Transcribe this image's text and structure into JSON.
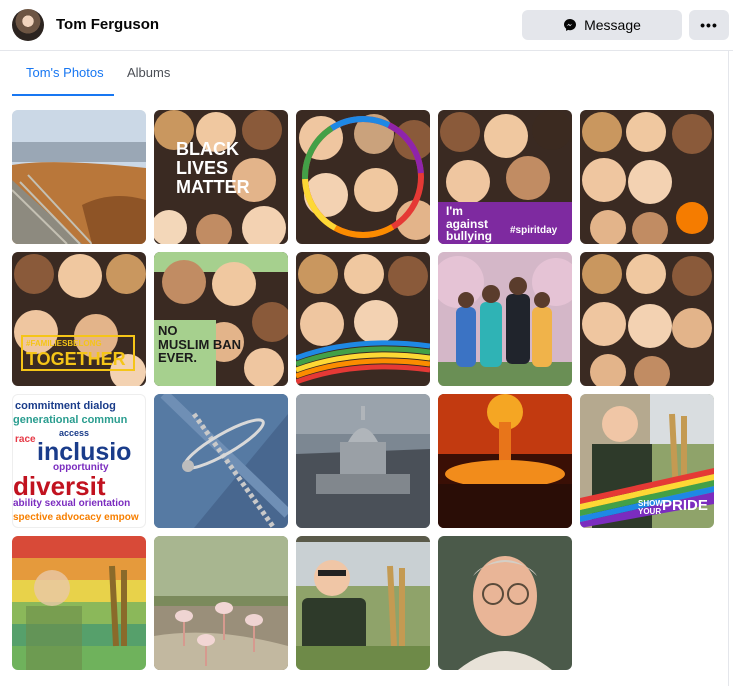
{
  "header": {
    "name": "Tom Ferguson",
    "message_label": "Message",
    "more_label": "•••"
  },
  "tabs": {
    "photos": "Tom's Photos",
    "albums": "Albums"
  },
  "tiles": {
    "blm": [
      "BLACK",
      "LIVES",
      "MATTER"
    ],
    "bully": [
      "I'm",
      "against",
      "bullying",
      "#spiritday"
    ],
    "families": [
      "#FAMILIESBELONG",
      "TOGETHER"
    ],
    "nomuslim": [
      "NO",
      "MUSLIM BAN",
      "EVER."
    ],
    "words": [
      "commitment dialog",
      "generational commun",
      "race",
      "access",
      "inclusio",
      "opportunity",
      "diversit",
      "ability sexual orientation",
      "spective advocacy empow"
    ],
    "pride": [
      "SHOW",
      "YOUR",
      "PRIDE"
    ]
  },
  "colors": {
    "accent": "#1877f2",
    "button_bg": "#e4e6eb"
  }
}
